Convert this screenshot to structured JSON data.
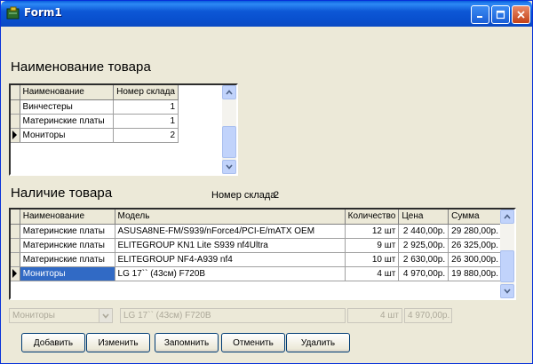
{
  "window": {
    "title": "Form1"
  },
  "section1": {
    "title": "Наименование товара",
    "headers": [
      "Наименование",
      "Номер склада"
    ],
    "rows": [
      {
        "name": "Винчестеры",
        "stock": "1"
      },
      {
        "name": "Материнские платы",
        "stock": "1"
      },
      {
        "name": "Мониторы",
        "stock": "2"
      }
    ]
  },
  "section2": {
    "title": "Наличие товара",
    "stock_label": "Номер склада",
    "stock_value": "2",
    "headers": [
      "Наименование",
      "Модель",
      "Количество",
      "Цена",
      "Сумма"
    ],
    "rows": [
      {
        "name": "Материнские платы",
        "model": "ASUSA8NE-FM/S939/nForce4/PCI-E/mATX OEM",
        "qty": "12 шт",
        "price": "2 440,00р.",
        "sum": "29 280,00р."
      },
      {
        "name": "Материнские платы",
        "model": "ELITEGROUP KN1 Lite S939 nf4Ultra",
        "qty": "9 шт",
        "price": "2 925,00р.",
        "sum": "26 325,00р."
      },
      {
        "name": "Материнские платы",
        "model": "ELITEGROUP NF4-A939 nf4",
        "qty": "10 шт",
        "price": "2 630,00р.",
        "sum": "26 300,00р."
      },
      {
        "name": "Мониторы",
        "model": "LG 17`` (43см) F720B",
        "qty": "4 шт",
        "price": "4 970,00р.",
        "sum": "19 880,00р."
      }
    ]
  },
  "editor": {
    "category": "Мониторы",
    "model": "LG 17`` (43см) F720B",
    "qty": "4 шт",
    "price": "4 970,00р."
  },
  "buttons": {
    "add": "Добавить",
    "edit": "Изменить",
    "save": "Запомнить",
    "cancel": "Отменить",
    "delete": "Удалить"
  },
  "colors": {
    "title_bar": "#0a53d0",
    "selection": "#316ac5",
    "window_bg": "#ece9d8"
  },
  "icons": [
    "app-icon",
    "minimize-icon",
    "maximize-icon",
    "close-icon",
    "row-pointer-icon",
    "scroll-up-icon",
    "scroll-down-icon",
    "dropdown-arrow-icon"
  ]
}
